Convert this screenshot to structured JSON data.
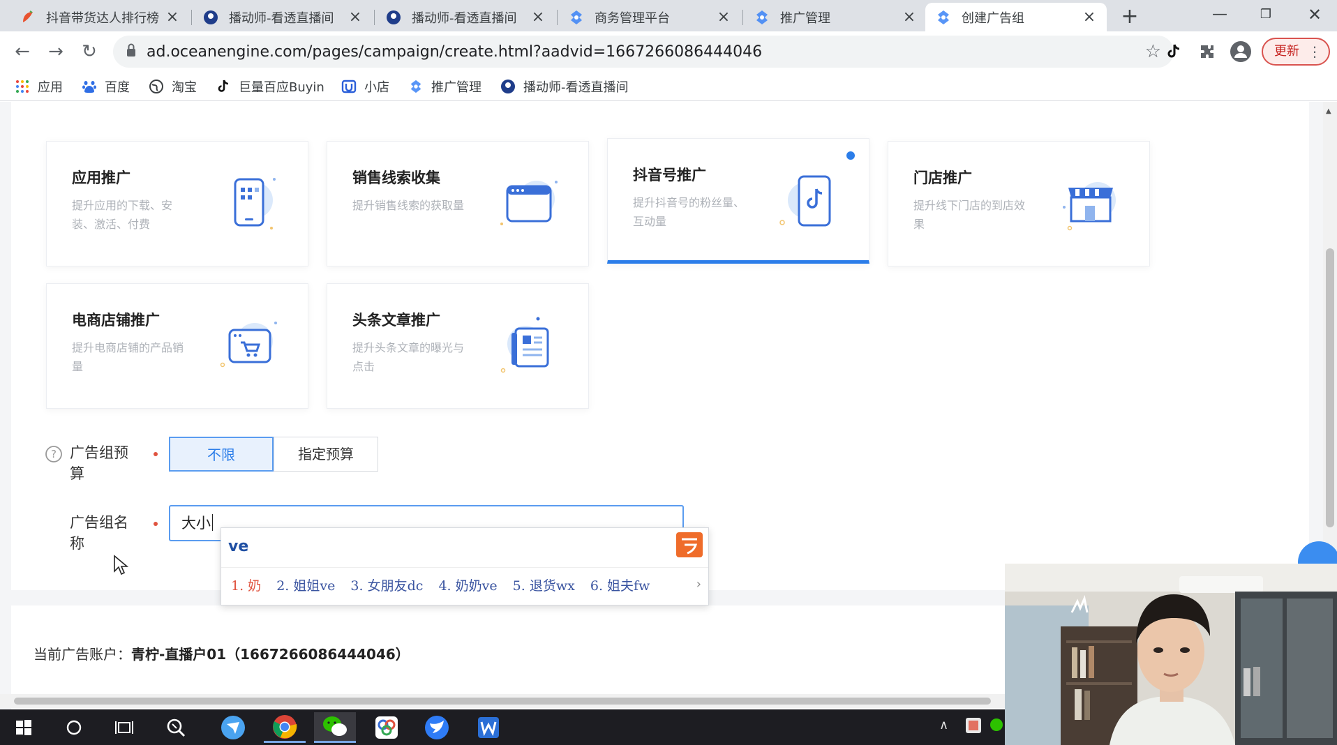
{
  "browser": {
    "tabs": [
      {
        "title": "抖音带货达人排行榜",
        "icon": "chili-icon",
        "active": false
      },
      {
        "title": "播动师-看透直播间",
        "icon": "bodongshi-icon",
        "active": false
      },
      {
        "title": "播动师-看透直播间",
        "icon": "bodongshi-icon",
        "active": false
      },
      {
        "title": "商务管理平台",
        "icon": "oceanengine-icon",
        "active": false
      },
      {
        "title": "推广管理",
        "icon": "oceanengine-icon",
        "active": false
      },
      {
        "title": "创建广告组",
        "icon": "oceanengine-icon",
        "active": true
      }
    ],
    "new_tab": "+",
    "url": "ad.oceanengine.com/pages/campaign/create.html?aadvid=1667266086444046",
    "update_label": "更新",
    "bookmarks": [
      {
        "label": "应用",
        "icon": "apps-grid-icon"
      },
      {
        "label": "百度",
        "icon": "baidu-paw-icon"
      },
      {
        "label": "淘宝",
        "icon": "globe-icon"
      },
      {
        "label": "巨量百应Buyin",
        "icon": "douyin-icon"
      },
      {
        "label": "小店",
        "icon": "doudian-icon"
      },
      {
        "label": "推广管理",
        "icon": "oceanengine-icon"
      },
      {
        "label": "播动师-看透直播间",
        "icon": "bodongshi-icon"
      }
    ]
  },
  "promotion_types": [
    {
      "title": "应用推广",
      "desc": "提升应用的下载、安装、激活、付费",
      "icon": "phone-app-icon",
      "selected": false
    },
    {
      "title": "销售线索收集",
      "desc": "提升销售线索的获取量",
      "icon": "browser-window-icon",
      "selected": false
    },
    {
      "title": "抖音号推广",
      "desc": "提升抖音号的粉丝量、互动量",
      "icon": "douyin-phone-icon",
      "selected": true
    },
    {
      "title": "门店推广",
      "desc": "提升线下门店的到店效果",
      "icon": "storefront-icon",
      "selected": false
    },
    {
      "title": "电商店铺推广",
      "desc": "提升电商店铺的产品销量",
      "icon": "shopping-cart-icon",
      "selected": false
    },
    {
      "title": "头条文章推广",
      "desc": "提升头条文章的曝光与点击",
      "icon": "article-icon",
      "selected": false
    }
  ],
  "form": {
    "budget_label_line1": "广告组预",
    "budget_label_line2": "算",
    "budget_options": [
      "不限",
      "指定预算"
    ],
    "name_label_line1": "广告组名",
    "name_label_line2": "称",
    "name_value": "大小"
  },
  "ime": {
    "pinyin": "ve",
    "candidates": [
      "1. 奶",
      "2. 姐姐ve",
      "3. 女朋友dc",
      "4. 奶奶ve",
      "5. 退货wx",
      "6. 姐夫fw"
    ],
    "more": "›"
  },
  "account": {
    "label": "当前广告账户：",
    "value": "青柠-直播户01（1667266086444046）"
  },
  "colors": {
    "primary": "#2b7de9",
    "required": "#e0533f",
    "update": "#c5221f"
  }
}
